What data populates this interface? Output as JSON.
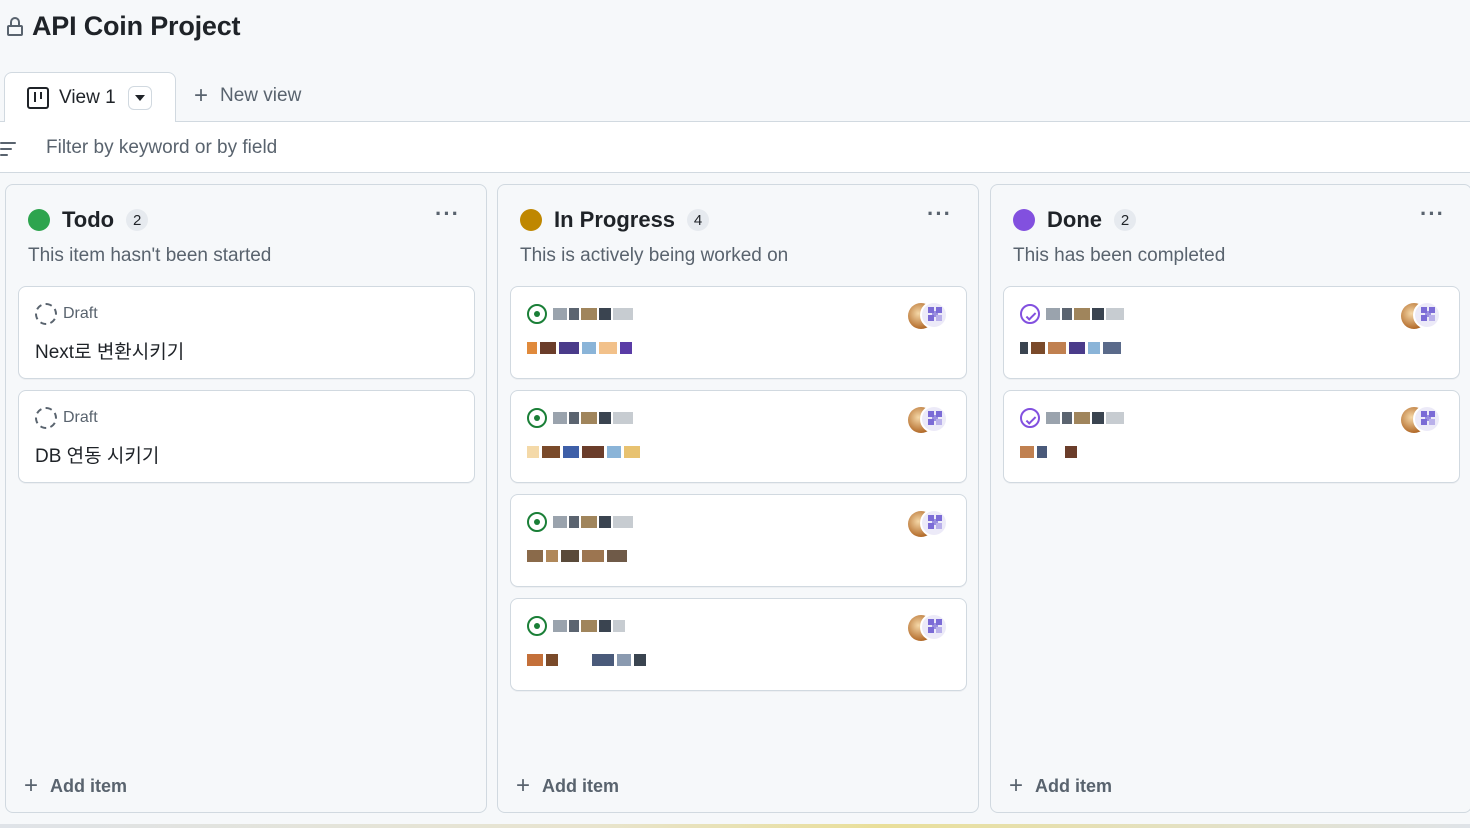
{
  "project": {
    "title": "API Coin Project"
  },
  "views": {
    "active": {
      "label": "View 1"
    },
    "new_view_label": "New view"
  },
  "filter": {
    "placeholder": "Filter by keyword or by field"
  },
  "columns": [
    {
      "name": "Todo",
      "count": "2",
      "color": "#2da44e",
      "description": "This item hasn't been started",
      "add_label": "Add item",
      "cards": [
        {
          "type": "draft",
          "meta": "Draft",
          "title": "Next로 변환시키기"
        },
        {
          "type": "draft",
          "meta": "Draft",
          "title": "DB 연동 시키기"
        }
      ]
    },
    {
      "name": "In Progress",
      "count": "4",
      "color": "#bf8700",
      "description": "This is actively being worked on",
      "add_label": "Add item",
      "cards": [
        {
          "type": "issue",
          "obscured": true
        },
        {
          "type": "issue",
          "obscured": true
        },
        {
          "type": "issue",
          "obscured": true
        },
        {
          "type": "issue",
          "obscured": true
        }
      ]
    },
    {
      "name": "Done",
      "count": "2",
      "color": "#8250df",
      "description": "This has been completed",
      "add_label": "Add item",
      "cards": [
        {
          "type": "issue-closed",
          "obscured": true
        },
        {
          "type": "issue-closed",
          "obscured": true
        }
      ]
    }
  ],
  "icons": {
    "lock": "lock-icon",
    "board": "board-icon",
    "caret": "caret-down-icon",
    "plus": "plus-icon",
    "filter": "filter-icon",
    "ellipsis": "kebab-icon",
    "draft": "draft-issue-icon",
    "issue_open": "issue-opened-icon",
    "issue_closed": "issue-closed-icon"
  }
}
